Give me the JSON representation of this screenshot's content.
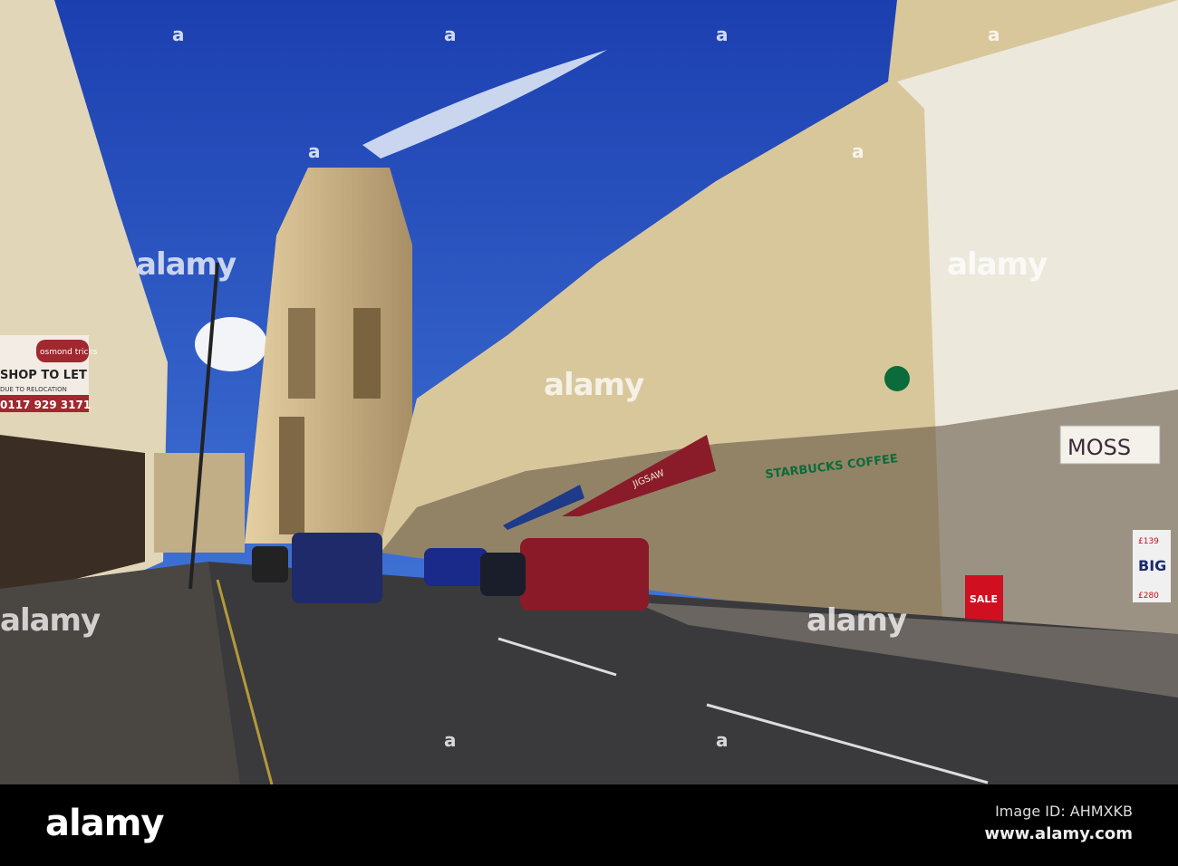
{
  "signs": {
    "agent_brand": "osmond tricks",
    "shop_to_let": "SHOP TO LET",
    "subline": "DUE TO RELOCATION",
    "phone": "0117 929 3171",
    "starbucks": "STARBUCKS COFFEE",
    "jigsaw": "JIGSAW",
    "moss": "MOSS",
    "sale": "SALE",
    "big": "BIG",
    "suit_price_1": "£139",
    "suit_price_2": "£280"
  },
  "watermark": {
    "text": "alamy",
    "letter": "a"
  },
  "footer": {
    "logo": "alamy",
    "image_id": "Image ID: AHMXKB",
    "site": "www.alamy.com"
  },
  "colors": {
    "sky": "#2a56c8",
    "stone": "#d8c49a",
    "road": "#3a3a3c",
    "awning": "#8a1c2a"
  }
}
